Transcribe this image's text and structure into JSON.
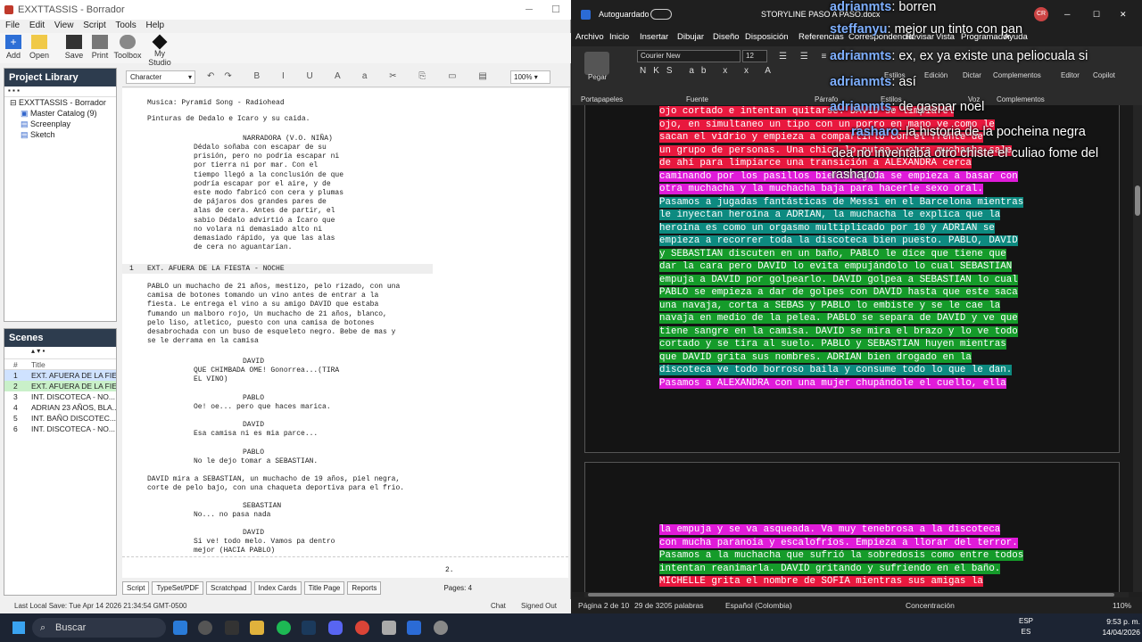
{
  "celtx": {
    "title": "EXXTTASSIS - Borrador",
    "menu": [
      "File",
      "Edit",
      "View",
      "Script",
      "Tools",
      "Help"
    ],
    "toolbar": [
      "Add",
      "Open",
      "Save",
      "Print",
      "Toolbox",
      "My Studio"
    ],
    "format_select": "Character",
    "zoom": "100%",
    "library": {
      "header": "Project Library",
      "root": "EXXTTASSIS - Borrador",
      "items": [
        "Master Catalog (9)",
        "Screenplay",
        "Sketch"
      ]
    },
    "scenes": {
      "header": "Scenes",
      "col_num": "#",
      "col_title": "Title",
      "rows": [
        {
          "n": "1",
          "t": "EXT. AFUERA DE LA FIE..."
        },
        {
          "n": "2",
          "t": "EXT. AFUERA DE LA FIE..."
        },
        {
          "n": "3",
          "t": "INT. DISCOTECA - NO..."
        },
        {
          "n": "4",
          "t": "ADRIAN 23 AÑOS, BLA..."
        },
        {
          "n": "5",
          "t": "INT. BAÑO DISCOTEC..."
        },
        {
          "n": "6",
          "t": "INT. DISCOTECA - NO..."
        }
      ]
    },
    "script": {
      "l1": "Musica: Pyramid Song - Radiohead",
      "l2": "Pinturas de Dedalo e Icaro y su caida.",
      "narr_char": "NARRADORA (V.O. NIÑA)",
      "narr": "Dédalo soñaba con escapar de su\nprisión, pero no podría escapar ni\npor tierra ni por mar. Con el\ntiempo llegó a la conclusión de que\npodría escapar por el aire, y de\neste modo fabricó con cera y plumas\nde pájaros dos grandes pares de\nalas de cera. Antes de partir, el\nsabio Dédalo advirtió a Ícaro que\nno volara ni demasiado alto ni\ndemasiado rápido, ya que las alas\nde cera no aguantarían.",
      "scene_num": "1",
      "scene_head": "EXT. AFUERA DE LA FIESTA - NOCHE",
      "action1": "PABLO un muchacho de 21 años, mestizo, pelo rizado, con una\ncamisa de botones tomando un vino antes de entrar a la\nfiesta. Le entrega el vino a su amigo DAVID que estaba\nfumando un malboro rojo, Un muchacho de 21 años, blanco,\npelo liso, atletico, puesto con una camisa de botones\ndesabrochada con un buso de esqueleto negro. Bebe de mas y\nse le derrama en la camisa",
      "c1": "DAVID",
      "d1": "QUE CHIMBADA OME! Gonorrea...(TIRA\nEL VINO)",
      "c2": "PABLO",
      "d2": "Oe! oe... pero que haces marica.",
      "c3": "DAVID",
      "d3": "Esa camisa ni es mia parce...",
      "c4": "PABLO",
      "d4": "No le dejo tomar a SEBASTIAN.",
      "action2": "DAVID mira a SEBASTIAN, un muchacho de 19 años, piel negra,\ncorte de pelo bajo, con una chaqueta deportiva para el frio.",
      "c5": "SEBASTIAN",
      "d5": "No... no pasa nada",
      "c6": "DAVID",
      "d6": "Si ve! todo melo. Vamos pa dentro\nmejor (HACIA PABLO)",
      "page_num": "2."
    },
    "tabs": [
      "Script",
      "TypeSet/PDF",
      "Scratchpad",
      "Index Cards",
      "Title Page",
      "Reports"
    ],
    "pages": "Pages: 4",
    "status": "Last Local Save: Tue Apr 14 2026 21:34:54 GMT-0500",
    "chat": "Chat",
    "signed": "Signed Out"
  },
  "word": {
    "autosave": "Autoguardado",
    "doc_title": "STORYLINE PASO A PASO.docx",
    "tabs": [
      "Archivo",
      "Inicio",
      "Insertar",
      "Dibujar",
      "Diseño",
      "Disposición",
      "Referencias",
      "Correspondencia",
      "Revisar",
      "Vista",
      "Programador",
      "Ayuda"
    ],
    "font": "Courier New",
    "size": "12",
    "groups": [
      "Portapapeles",
      "Fuente",
      "Párrafo",
      "Estilos",
      "Edición",
      "Dictar",
      "Complementos",
      "Editor",
      "Copilot",
      "Voz",
      "Complementos"
    ],
    "paste": "Pegar",
    "page1": [
      {
        "c": "r",
        "t": "ojo cortado e intentan quitarse. DAVID se limpia el"
      },
      {
        "c": "r",
        "t": "ojo, en simultaneo un tipo con un porro en mano ve como le"
      },
      {
        "c": "r",
        "t": "sacan el vidrio y empieza a compartirlo con el frente de"
      },
      {
        "c": "r",
        "t": "un grupo de personas. Una chica lo putea y otra muchacha sale"
      },
      {
        "c": "r",
        "t": "de ahí para limpiarce una transición a ALEXANDRA cerca"
      },
      {
        "c": "m",
        "t": "caminando por los pasillos bien drogada se empieza a basar con"
      },
      {
        "c": "m",
        "t": "otra muchacha y la muchacha baja para hacerle sexo oral."
      },
      {
        "c": "t",
        "t": "Pasamos a jugadas fantásticas de Messi en el Barcelona mientras"
      },
      {
        "c": "t",
        "t": "le inyectan heroína a ADRIAN, la muchacha le explica que la"
      },
      {
        "c": "t",
        "t": "heroína es como un orgasmo multiplicado por 10 y ADRIAN se"
      },
      {
        "c": "t",
        "t": "empieza a recorrer toda la discoteca bien puesto. PABLO, DAVID"
      },
      {
        "c": "g",
        "t": "y SEBASTIAN discuten en un baño, PABLO le dice que tiene que"
      },
      {
        "c": "g",
        "t": "dar la cara pero DAVID lo evita empujándolo lo cual SEBASTIAN"
      },
      {
        "c": "g",
        "t": "empuja a DAVID por golpearlo. DAVID golpea a SEBASTIAN lo cual"
      },
      {
        "c": "g",
        "t": "PABLO se empieza a dar de golpes con DAVID hasta que este saca"
      },
      {
        "c": "g",
        "t": "una navaja, corta a SEBAS y PABLO lo embiste y se le cae la"
      },
      {
        "c": "g",
        "t": "navaja en medio de la pelea. PABLO se separa de DAVID y ve que"
      },
      {
        "c": "g",
        "t": "tiene sangre en la camisa. DAVID se mira el brazo y lo ve todo"
      },
      {
        "c": "g",
        "t": "cortado y se tira al suelo. PABLO y SEBASTIAN huyen mientras"
      },
      {
        "c": "g",
        "t": "que DAVID grita sus nombres. ADRIAN bien drogado en la"
      },
      {
        "c": "t",
        "t": "discoteca ve todo borroso baila y consume todo lo que le dan."
      },
      {
        "c": "m",
        "t": "Pasamos a ALEXANDRA con una mujer chupándole el cuello, ella"
      }
    ],
    "page2": [
      {
        "c": "m",
        "t": "la empuja y se va asqueada. Va muy tenebrosa a la discoteca"
      },
      {
        "c": "m",
        "t": "con mucha paranoia y escalofríos. Empieza a llorar del terror."
      },
      {
        "c": "g",
        "t": "Pasamos a la muchacha que sufrió la sobredosis como entre todos"
      },
      {
        "c": "g",
        "t": "intentan reanimarla. DAVID gritando y sufriendo en el baño."
      },
      {
        "c": "r",
        "t": "MICHELLE grita el nombre de SOFIA mientras sus amigas la"
      }
    ],
    "status": {
      "page": "Página 2 de 10",
      "words": "29 de 3205 palabras",
      "lang": "Español (Colombia)",
      "focus": "Concentración",
      "zoom": "110%"
    }
  },
  "chat": [
    {
      "user": "adrianmts",
      "msg": "borren"
    },
    {
      "user": "steffanyu",
      "msg": "mejor un tinto con pan"
    },
    {
      "user": "adrianmts",
      "msg": "ex, ex ya existe una peliocuala si"
    },
    {
      "user": "adrianmts",
      "msg": "así"
    },
    {
      "user": "adrianmts",
      "msg": "de gaspar noel"
    },
    {
      "user": "rasharo",
      "msg": "la historia de la pocheina negra"
    },
    {
      "user": "",
      "msg": "dea no inventaba otro chiste el culiao fome del"
    },
    {
      "user": "",
      "msg": "rasharo"
    }
  ],
  "taskbar": {
    "search": "Buscar",
    "lang1": "ESP",
    "lang2": "ES",
    "time": "9:53 p. m.",
    "date": "14/04/2026"
  },
  "colors": {
    "red": "#e8183e",
    "magenta": "#e01bd9",
    "teal": "#0d8a80",
    "green": "#159b2a"
  }
}
